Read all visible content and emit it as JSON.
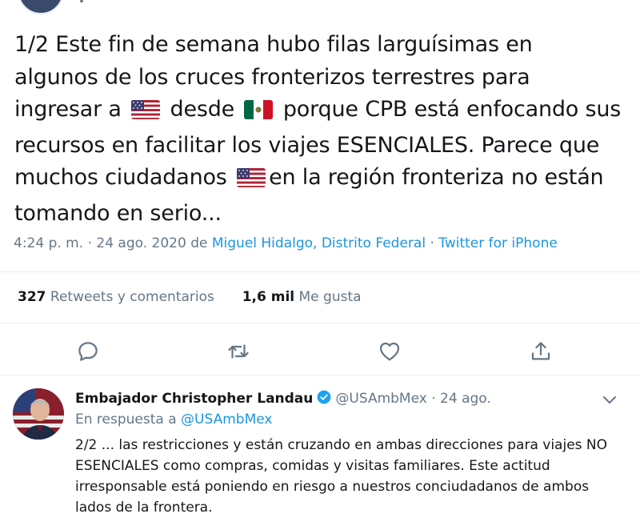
{
  "tweet": {
    "text_parts": [
      "1/2 Este fin de semana hubo filas larguísimas en algunos de los cruces fronterizos terrestres para ingresar a",
      "desde",
      "porque CPB está enfocando sus recursos en facilitar los viajes ESENCIALES. Parece que muchos ciudadanos",
      "en la región fronteriza no están tomando en serio..."
    ],
    "flags": {
      "us": "us-flag-icon",
      "mx": "mexico-flag-icon"
    },
    "time": "4:24 p. m.",
    "dot1": "·",
    "date": "24 ago. 2020",
    "de": "de",
    "location": "Miguel Hidalgo, Distrito Federal",
    "dot2": "·",
    "source": "Twitter for iPhone"
  },
  "stats": {
    "retweets_count": "327",
    "retweets_label": "Retweets y comentarios",
    "likes_count": "1,6 mil",
    "likes_label": "Me gusta"
  },
  "actions": {
    "icons": [
      "reply-icon",
      "retweet-icon",
      "like-icon",
      "share-icon"
    ]
  },
  "reply": {
    "author_name": "Embajador Christopher Landau",
    "handle": "@USAmbMex",
    "dot": "·",
    "time": "24 ago.",
    "in_reply_prefix": "En respuesta a",
    "in_reply_handle": "@USAmbMex",
    "text": "2/2 ... las restricciones y están cruzando en ambas direcciones para viajes NO ESENCIALES como compras, comidas y visitas familiares. Este actitud irresponsable está poniendo en riesgo a nuestros conciudadanos de ambos lados de la frontera."
  },
  "colors": {
    "text": "#14171a",
    "secondary": "#657786",
    "link": "#1b95e0",
    "divider": "#e6ecf0",
    "verified": "#1da1f2"
  }
}
